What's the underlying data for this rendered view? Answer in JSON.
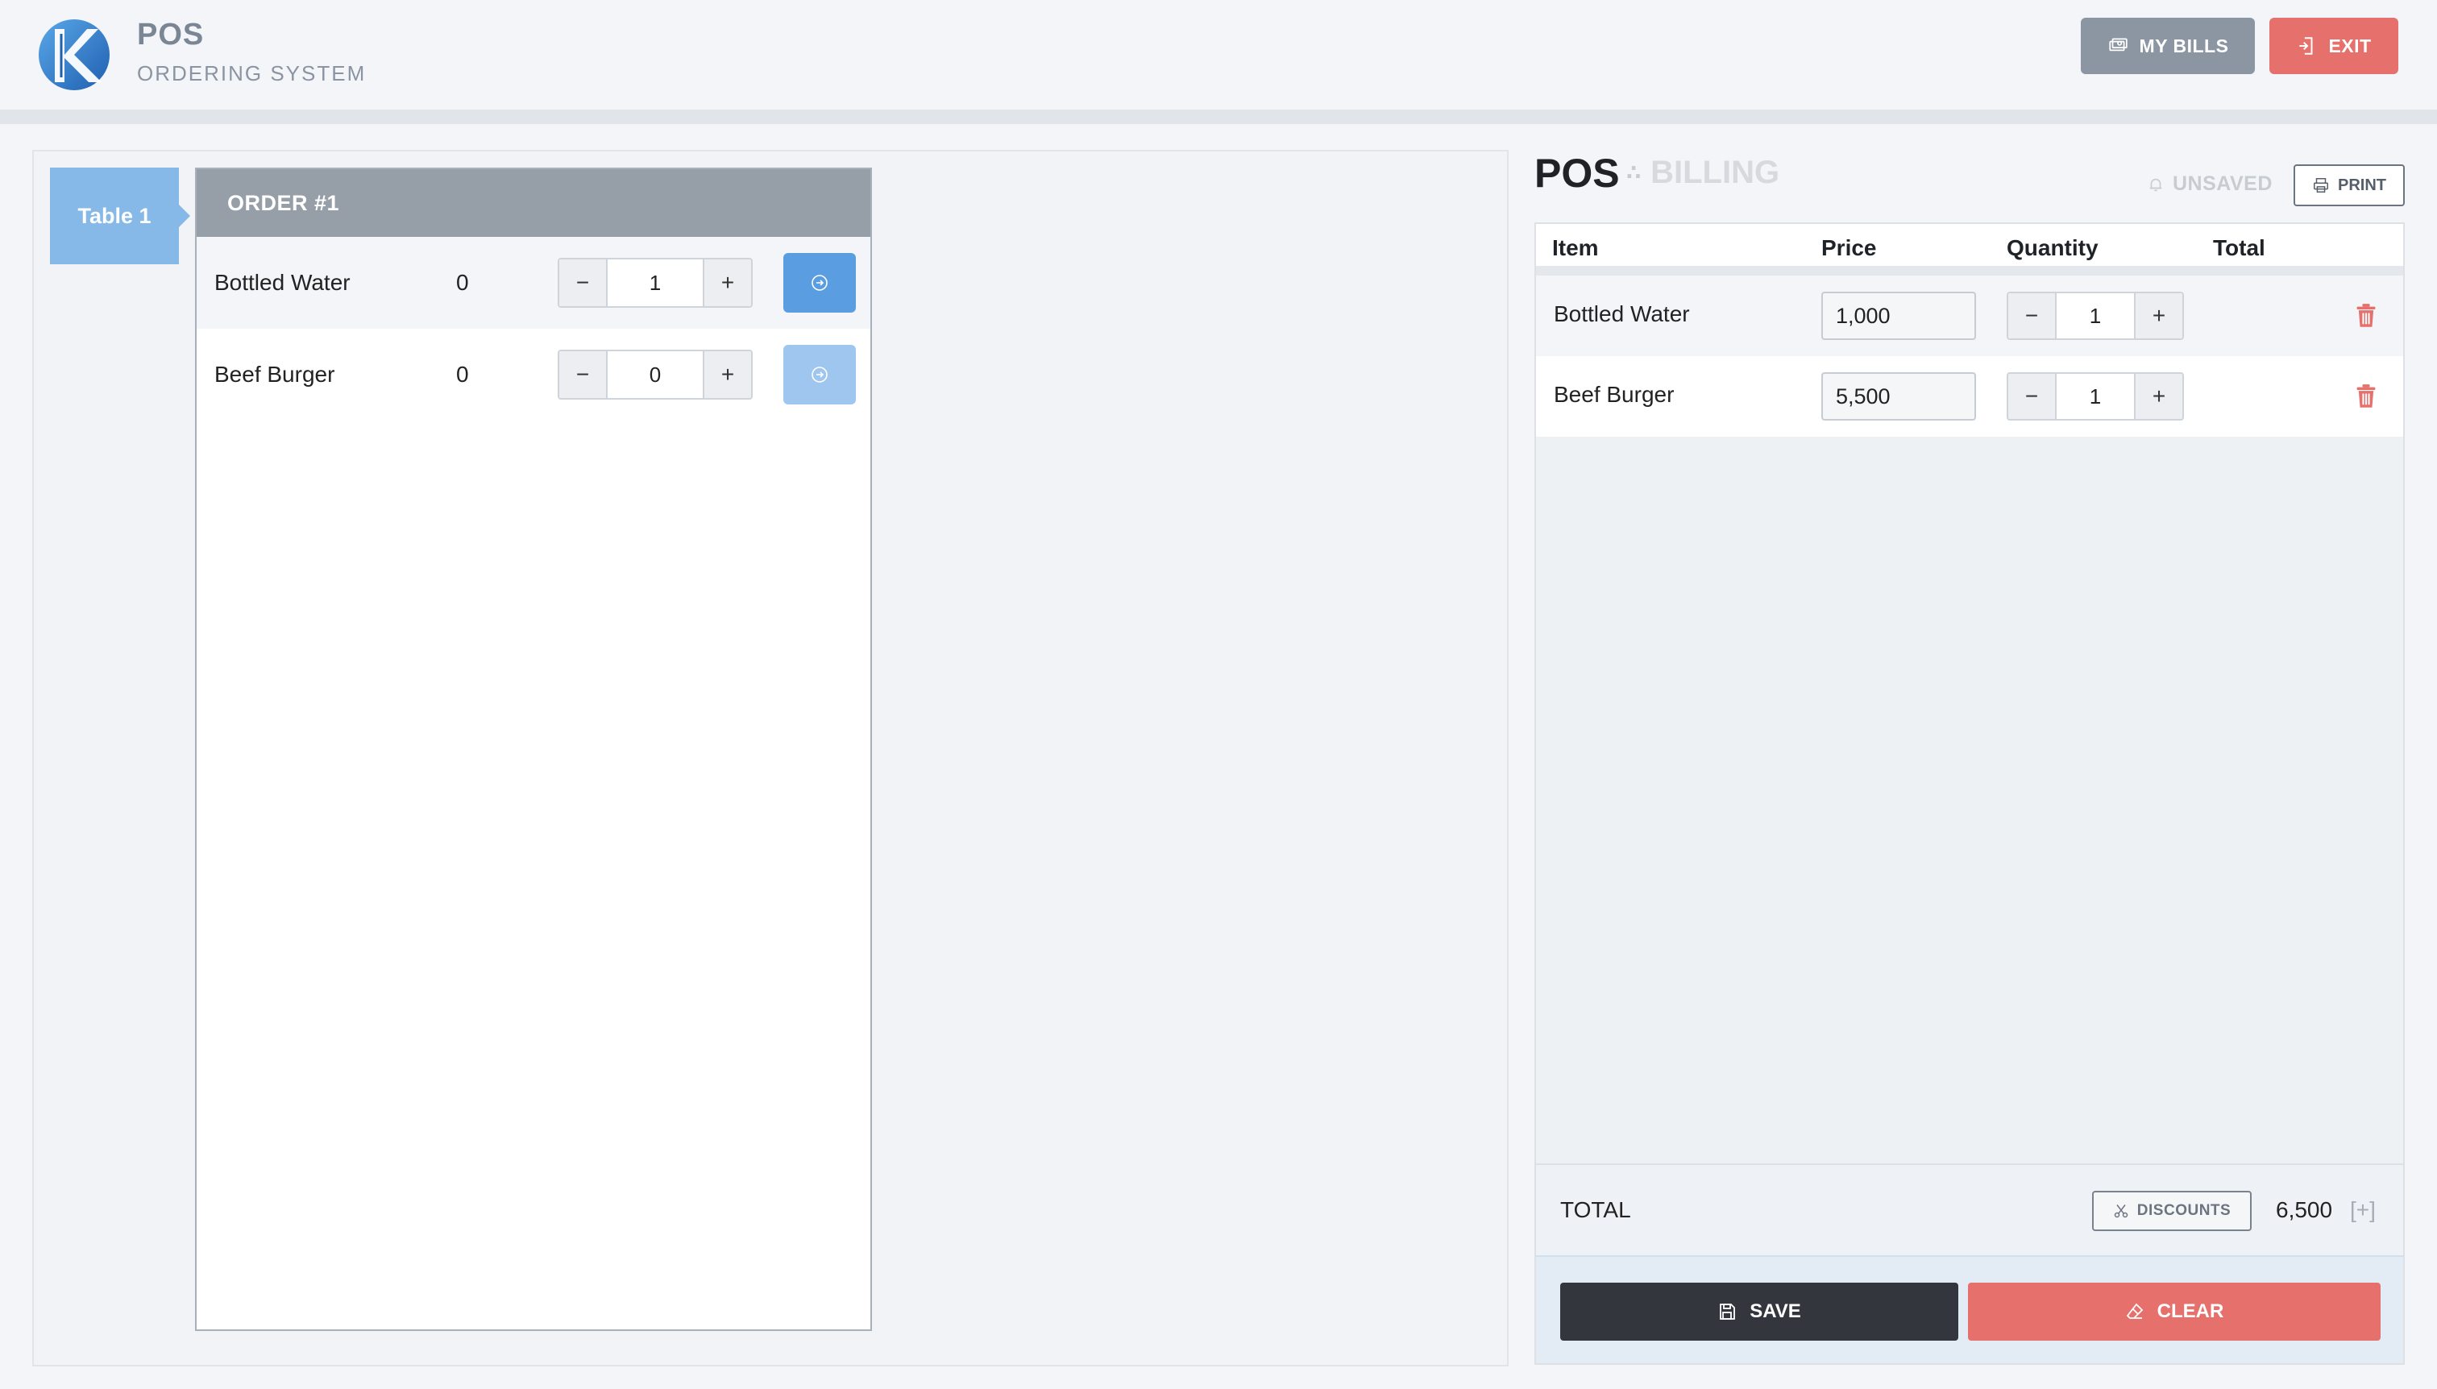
{
  "header": {
    "title": "POS",
    "subtitle": "ORDERING SYSTEM",
    "my_bills_label": "MY BILLS",
    "exit_label": "EXIT"
  },
  "tables": {
    "active_tab": "Table 1"
  },
  "order": {
    "title": "ORDER #1",
    "items": [
      {
        "name": "Bottled Water",
        "count": "0",
        "qty": "1"
      },
      {
        "name": "Beef Burger",
        "count": "0",
        "qty": "0"
      }
    ]
  },
  "billing": {
    "title": "POS",
    "subtitle": "BILLING",
    "status": "UNSAVED",
    "print_label": "PRINT",
    "columns": [
      "Item",
      "Price",
      "Quantity",
      "Total"
    ],
    "rows": [
      {
        "item": "Bottled Water",
        "price": "1,000",
        "qty": "1"
      },
      {
        "item": "Beef Burger",
        "price": "5,500",
        "qty": "1"
      }
    ],
    "total_label": "TOTAL",
    "discounts_label": "DISCOUNTS",
    "total_value": "6,500",
    "total_extra": "[+]",
    "save_label": "SAVE",
    "clear_label": "CLEAR"
  },
  "colors": {
    "primary": "#5a9de0",
    "danger": "#e6706c",
    "dark": "#33373d",
    "muted": "#8c96a3"
  }
}
